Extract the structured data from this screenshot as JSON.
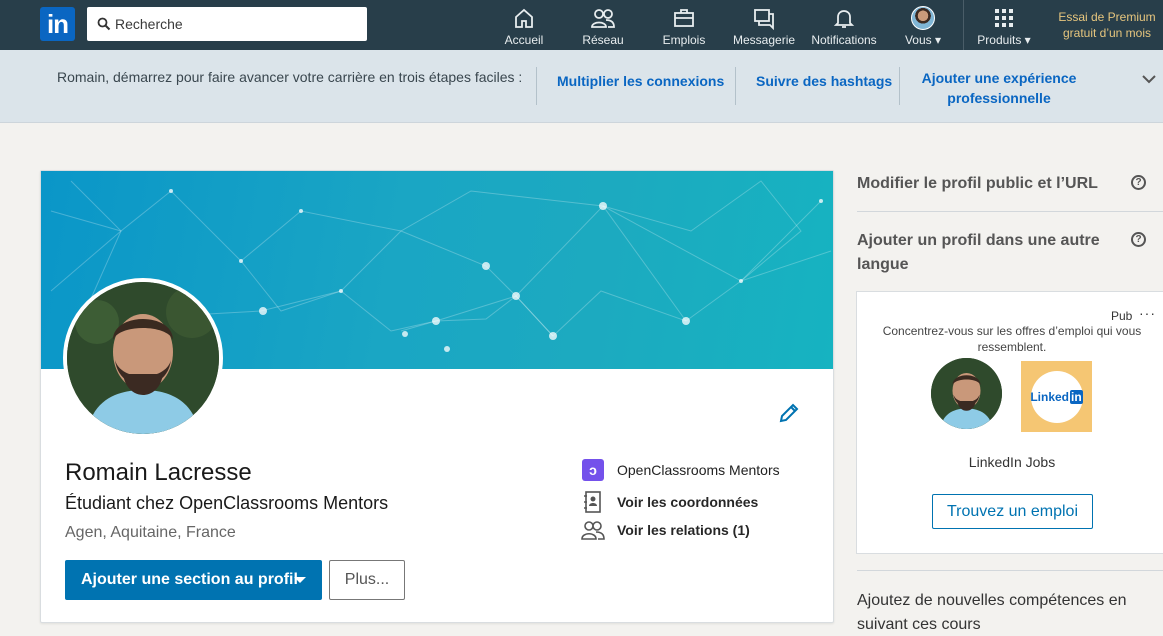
{
  "nav": {
    "logo": "in",
    "search_placeholder": "Recherche",
    "items": [
      {
        "label": "Accueil",
        "icon": "home-icon"
      },
      {
        "label": "Réseau",
        "icon": "network-icon"
      },
      {
        "label": "Emplois",
        "icon": "briefcase-icon"
      },
      {
        "label": "Messagerie",
        "icon": "messaging-icon"
      },
      {
        "label": "Notifications",
        "icon": "bell-icon"
      },
      {
        "label": "Vous",
        "icon": "avatar"
      },
      {
        "label": "Produits",
        "icon": "grid-icon"
      }
    ],
    "premium_line1": "Essai de Premium",
    "premium_line2": "gratuit d’un mois"
  },
  "guide": {
    "text": "Romain, démarrez pour faire avancer votre carrière en trois étapes faciles :",
    "links": [
      "Multiplier les connexions",
      "Suivre des hashtags",
      "Ajouter une expérience professionnelle"
    ]
  },
  "profile": {
    "name": "Romain Lacresse",
    "headline": "Étudiant chez OpenClassrooms Mentors",
    "location": "Agen, Aquitaine, France",
    "add_section_label": "Ajouter une section au profil",
    "more_label": "Plus...",
    "company": "OpenClassrooms Mentors",
    "contact": "Voir les coordonnées",
    "connections": "Voir les relations (1)"
  },
  "rail": {
    "edit_public": "Modifier le profil public et l’URL",
    "add_language": "Ajouter un profil dans une autre langue",
    "bottom": "Ajoutez de nouvelles compétences en suivant ces cours"
  },
  "ad": {
    "pub": "Pub",
    "more": "···",
    "text": "Concentrez-vous sur les offres d’emploi qui vous ressemblent.",
    "logo_text": "Linked",
    "logo_in": "in",
    "name": "LinkedIn Jobs",
    "button": "Trouvez un emploi"
  },
  "colors": {
    "nav_bg": "#283e4a",
    "primary": "#0073b1",
    "banner": "#1aa6c4",
    "premium": "#e7c67e"
  }
}
